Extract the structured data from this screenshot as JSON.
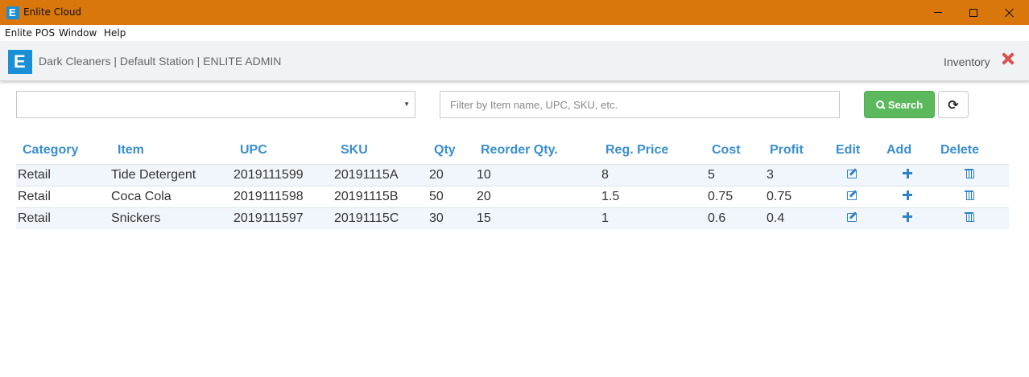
{
  "window": {
    "title": "Enlite Cloud"
  },
  "menubar": {
    "items": [
      "Enlite POS",
      "Window",
      "Help"
    ]
  },
  "header": {
    "org_line": "Dark Cleaners | Default Station | ENLITE ADMIN",
    "module": "Inventory"
  },
  "filter": {
    "category_value": "",
    "search_placeholder": "Filter by Item name, UPC, SKU, etc.",
    "search_value": "",
    "search_label": "Search"
  },
  "table": {
    "columns": [
      "Category",
      "Item",
      "UPC",
      "SKU",
      "Qty",
      "Reorder Qty.",
      "Reg. Price",
      "Cost",
      "Profit",
      "Edit",
      "Add",
      "Delete"
    ],
    "rows": [
      {
        "category": "Retail",
        "item": "Tide Detergent",
        "upc": "2019111599",
        "sku": "20191115A",
        "qty": "20",
        "reorder": "10",
        "price": "8",
        "cost": "5",
        "profit": "3"
      },
      {
        "category": "Retail",
        "item": "Coca Cola",
        "upc": "2019111598",
        "sku": "20191115B",
        "qty": "50",
        "reorder": "20",
        "price": "1.5",
        "cost": "0.75",
        "profit": "0.75"
      },
      {
        "category": "Retail",
        "item": "Snickers",
        "upc": "2019111597",
        "sku": "20191115C",
        "qty": "30",
        "reorder": "15",
        "price": "1",
        "cost": "0.6",
        "profit": "0.4"
      }
    ]
  },
  "colors": {
    "titlebar": "#d9770c",
    "accent": "#3a8fd0",
    "search_button": "#5cb85c",
    "close_icon": "#d9534f"
  }
}
